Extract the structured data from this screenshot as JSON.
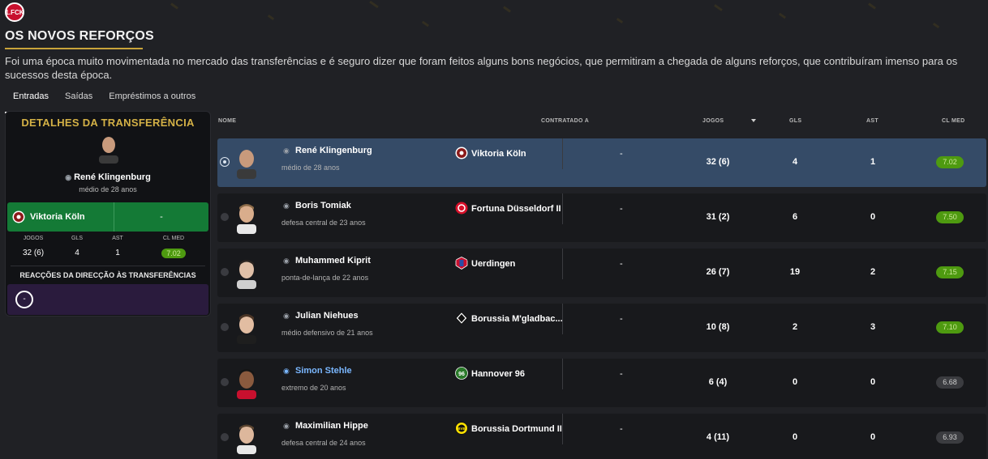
{
  "header": {
    "title": "OS NOVOS REFORÇOS",
    "intro": "Foi uma época muito movimentada no mercado das transferências e é seguro dizer que foram feitos alguns bons negócios, que permitiram a chegada de alguns reforços, que contribuíram imenso para os sucessos desta época."
  },
  "tabs": [
    {
      "label": "Entradas",
      "active": true
    },
    {
      "label": "Saídas",
      "active": false
    },
    {
      "label": "Empréstimos a outros",
      "active": false
    }
  ],
  "details": {
    "title": "DETALHES DA TRANSFERÊNCIA",
    "name": "René Klingenburg",
    "role": "médio de 28 anos",
    "club": "Viktoria Köln",
    "fee": "-",
    "stats": {
      "labels": [
        "JOGOS",
        "GLS",
        "AST",
        "CL MED"
      ],
      "values": [
        "32 (6)",
        "4",
        "1",
        "7.02"
      ]
    },
    "reactions_title": "REACÇÕES DA DIRECÇÃO ÀS TRANSFERÊNCIAS",
    "reaction_value": "-"
  },
  "table": {
    "columns": [
      "NOME",
      "CONTRATADO A",
      "JOGOS",
      "GLS",
      "AST",
      "CL MED"
    ],
    "rows": [
      {
        "name": "René Klingenburg",
        "role": "médio de 28 anos",
        "club": "Viktoria Köln",
        "fee": "-",
        "apps": "32 (6)",
        "goals": "4",
        "assists": "1",
        "rating": "7.02",
        "rating_color": "green",
        "selected": true
      },
      {
        "name": "Boris Tomiak",
        "role": "defesa central de 23 anos",
        "club": "Fortuna Düsseldorf II",
        "fee": "-",
        "apps": "31 (2)",
        "goals": "6",
        "assists": "0",
        "rating": "7.50",
        "rating_color": "green",
        "selected": false
      },
      {
        "name": "Muhammed Kiprit",
        "role": "ponta-de-lança de 22 anos",
        "club": "Uerdingen",
        "fee": "-",
        "apps": "26 (7)",
        "goals": "19",
        "assists": "2",
        "rating": "7.15",
        "rating_color": "green",
        "selected": false
      },
      {
        "name": "Julian Niehues",
        "role": "médio defensivo de 21 anos",
        "club": "Borussia M'gladbac...",
        "fee": "-",
        "apps": "10 (8)",
        "goals": "2",
        "assists": "3",
        "rating": "7.10",
        "rating_color": "green",
        "selected": false
      },
      {
        "name": "Simon Stehle",
        "role": "extremo de 20 anos",
        "club": "Hannover 96",
        "fee": "-",
        "apps": "6 (4)",
        "goals": "0",
        "assists": "0",
        "rating": "6.68",
        "rating_color": "grey",
        "selected": false
      },
      {
        "name": "Maximilian Hippe",
        "role": "defesa central de 24 anos",
        "club": "Borussia Dortmund II",
        "fee": "-",
        "apps": "4 (11)",
        "goals": "0",
        "assists": "0",
        "rating": "6.93",
        "rating_color": "grey",
        "selected": false
      }
    ]
  },
  "colors": {
    "accent_gold": "#d4b146",
    "selected_row": "#354b67",
    "club_green": "#147a36",
    "rating_green": "#4e9a10",
    "link_blue": "#7ab7ff"
  }
}
